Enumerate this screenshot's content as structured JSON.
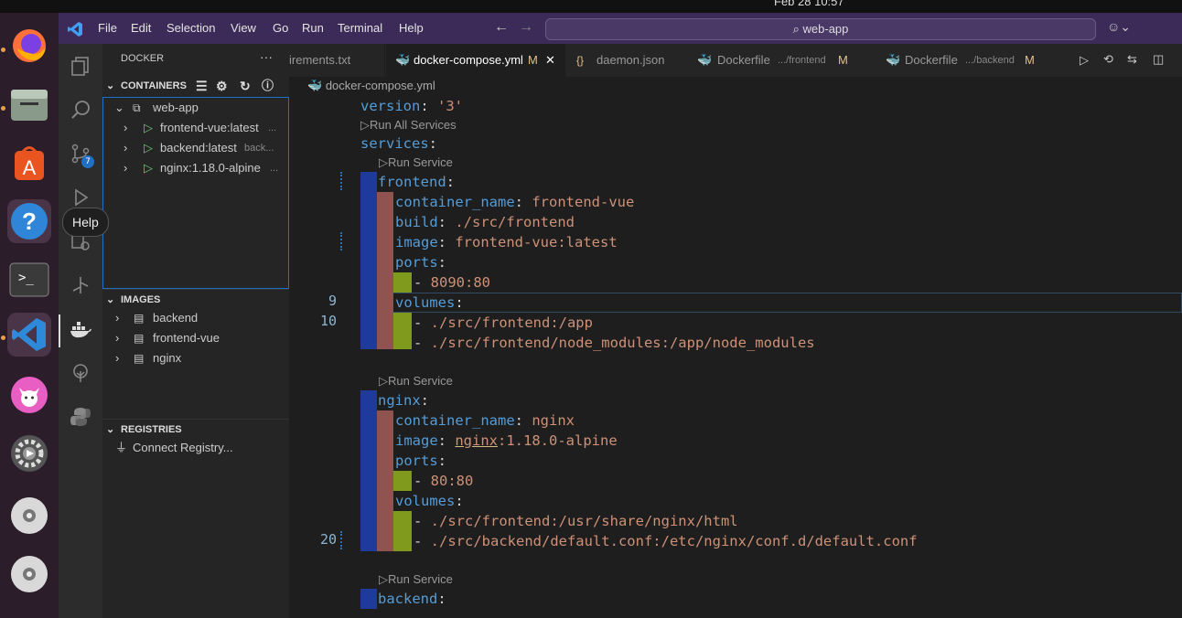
{
  "system": {
    "clock": "Feb 28 10:57"
  },
  "dock": {
    "tooltip": "Help"
  },
  "titlebar": {
    "menu": [
      "File",
      "Edit",
      "Selection",
      "View",
      "Go",
      "Run",
      "Terminal",
      "Help"
    ],
    "search_text": "web-app"
  },
  "sidebar": {
    "title": "DOCKER",
    "more": "···",
    "containers_header": "CONTAINERS",
    "group": "web-app",
    "containers": [
      {
        "name": "frontend-vue:latest",
        "detail": "..."
      },
      {
        "name": "backend:latest",
        "detail": "back..."
      },
      {
        "name": "nginx:1.18.0-alpine",
        "detail": "..."
      }
    ],
    "images_header": "IMAGES",
    "images": [
      "backend",
      "frontend-vue",
      "nginx"
    ],
    "registries_header": "REGISTRIES",
    "connect_registry": "Connect Registry..."
  },
  "tabs": [
    {
      "name": "irements.txt",
      "path": "",
      "status": ""
    },
    {
      "name": "docker-compose.yml",
      "path": "",
      "status": "M"
    },
    {
      "name": "daemon.json",
      "path": "",
      "status": ""
    },
    {
      "name": "Dockerfile",
      "path": ".../frontend",
      "status": "M"
    },
    {
      "name": "Dockerfile",
      "path": ".../backend",
      "status": "M"
    }
  ],
  "source_control_badge": "7",
  "editor": {
    "breadcrumb": "docker-compose.yml",
    "run_all": "Run All Services",
    "run_service": "Run Service",
    "line_numbers": {
      "a": "9",
      "b": "10",
      "c": "20"
    },
    "code": {
      "version_key": "version",
      "version_val": "'3'",
      "services_key": "services",
      "frontend": "frontend",
      "container_name_key": "container_name",
      "frontend_cname": "frontend-vue",
      "build_key": "build",
      "build_val": "./src/frontend",
      "image_key": "image",
      "frontend_image": "frontend-vue:latest",
      "ports_key": "ports",
      "frontend_port": "8090:80",
      "volumes_key": "volumes",
      "frontend_vol1": "./src/frontend:/app",
      "frontend_vol2": "./src/frontend/node_modules:/app/node_modules",
      "nginx": "nginx",
      "nginx_cname": "nginx",
      "nginx_image_a": "nginx",
      "nginx_image_b": ":1.18.0-alpine",
      "nginx_port": "80:80",
      "nginx_vol1": "./src/frontend:/usr/share/nginx/html",
      "nginx_vol2": "./src/backend/default.conf:/etc/nginx/conf.d/default.conf",
      "backend": "backend"
    }
  }
}
